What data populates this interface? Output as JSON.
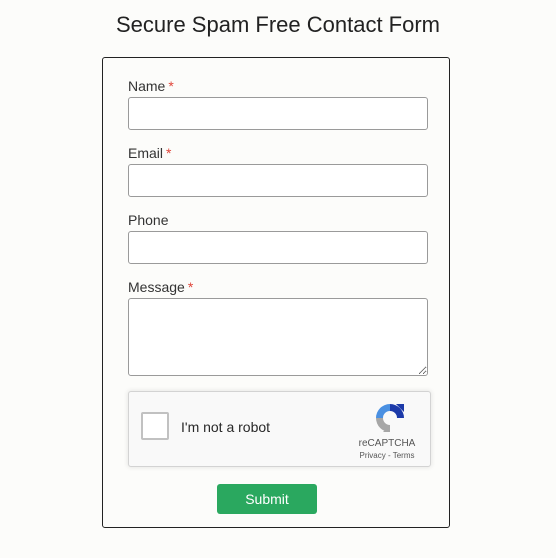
{
  "page": {
    "title": "Secure Spam Free Contact Form"
  },
  "form": {
    "fields": {
      "name": {
        "label": "Name",
        "required_mark": "*",
        "value": ""
      },
      "email": {
        "label": "Email",
        "required_mark": "*",
        "value": ""
      },
      "phone": {
        "label": "Phone",
        "value": ""
      },
      "message": {
        "label": "Message",
        "required_mark": "*",
        "value": ""
      }
    },
    "recaptcha": {
      "label": "I'm not a robot",
      "checked": false,
      "brand": "reCAPTCHA",
      "privacy_link": "Privacy",
      "separator": " - ",
      "terms_link": "Terms",
      "logo_icon": "recaptcha-logo-icon"
    },
    "submit_label": "Submit"
  },
  "colors": {
    "background": "#fcfcfa",
    "required_mark": "#e0453a",
    "submit_button": "#2aa85f",
    "card_border": "#222222",
    "recaptcha_blue": "#1c3aa9",
    "recaptcha_lightblue": "#4a90e2",
    "recaptcha_gray": "#a6a6a6"
  }
}
